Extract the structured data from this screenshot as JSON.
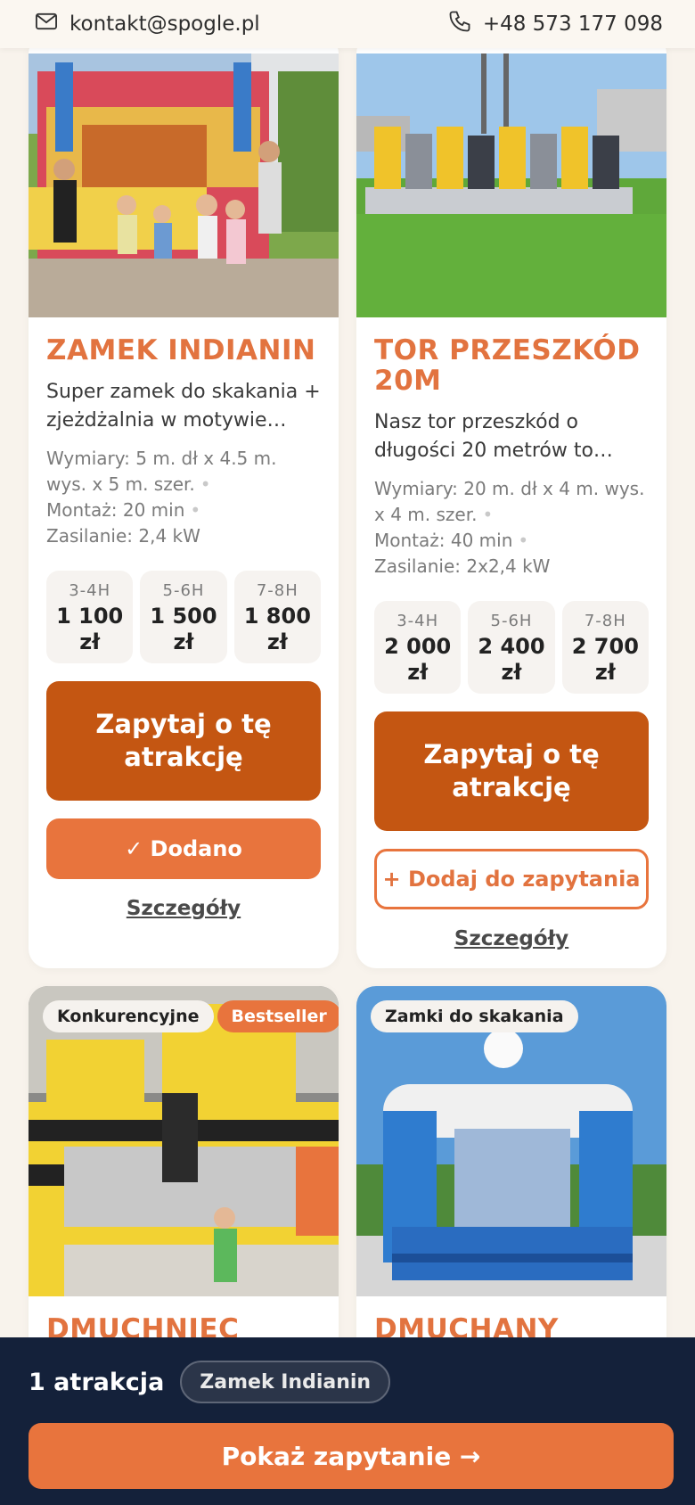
{
  "topbar": {
    "email": "kontakt@spogle.pl",
    "phone": "+48 573 177 098",
    "email_icon": "mail-icon",
    "phone_icon": "phone-icon"
  },
  "cards": [
    {
      "title": "Zamek Indianin",
      "description": "Super zamek do skakania + zjeżdżalnia w motywie…",
      "specs": [
        "Wymiary: 5 m. dł x 4.5 m. wys. x 5 m. szer.",
        "Montaż: 20 min",
        "Zasilanie: 2,4 kW"
      ],
      "prices": [
        {
          "duration": "3-4H",
          "amount": "1 100 zł"
        },
        {
          "duration": "5-6H",
          "amount": "1 500 zł"
        },
        {
          "duration": "7-8H",
          "amount": "1 800 zł"
        }
      ],
      "ask_label": "Zapytaj o tę atrakcję",
      "add_label": "✓ Dodano",
      "added": true,
      "details_label": "Szczegóły"
    },
    {
      "title": "Tor przeszkód 20m",
      "description": "Nasz tor przeszkód o długości 20 metrów to…",
      "specs": [
        "Wymiary: 20 m. dł x 4 m. wys. x 4 m. szer.",
        "Montaż: 40 min",
        "Zasilanie: 2x2,4 kW"
      ],
      "prices": [
        {
          "duration": "3-4H",
          "amount": "2 000 zł"
        },
        {
          "duration": "5-6H",
          "amount": "2 400 zł"
        },
        {
          "duration": "7-8H",
          "amount": "2 700 zł"
        }
      ],
      "ask_label": "Zapytaj o tę atrakcję",
      "add_label": "+ Dodaj do zapytania",
      "added": false,
      "details_label": "Szczegóły"
    },
    {
      "title": "Dmuchniec",
      "badges": [
        "Konkurencyjne",
        "Bestseller"
      ]
    },
    {
      "title": "Dmuchany",
      "badges": [
        "Zamki do skakania"
      ]
    }
  ],
  "bottom_bar": {
    "count_label": "1 atrakcja",
    "chip_label": "Zamek Indianin",
    "show_label": "Pokaż zapytanie →"
  }
}
